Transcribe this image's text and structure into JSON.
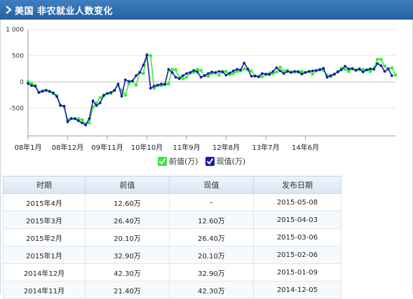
{
  "header": {
    "title": "美国 非农就业人数变化",
    "icon": "chevron-right-icon"
  },
  "legend": {
    "prev_label": "前值(万)",
    "curr_label": "现值(万)"
  },
  "table": {
    "headers": [
      "时期",
      "前值",
      "现值",
      "发布日期"
    ],
    "rows": [
      [
        "2015年4月",
        "12.60万",
        "–",
        "2015-05-08"
      ],
      [
        "2015年3月",
        "26.40万",
        "12.60万",
        "2015-04-03"
      ],
      [
        "2015年2月",
        "20.10万",
        "26.40万",
        "2015-03-06"
      ],
      [
        "2015年1月",
        "32.90万",
        "20.10万",
        "2015-02-06"
      ],
      [
        "2014年12月",
        "42.30万",
        "32.90万",
        "2015-01-09"
      ],
      [
        "2014年11月",
        "21.40万",
        "42.30万",
        "2014-12-05"
      ]
    ]
  },
  "chart_data": {
    "type": "line",
    "ylim": [
      -1000,
      1000
    ],
    "yticks": [
      1000,
      500,
      0,
      -500
    ],
    "ytick_labels": [
      "1 000",
      "500",
      "0",
      "-500"
    ],
    "xtick_labels": [
      "08年1月",
      "08年12月",
      "09年11月",
      "10年10月",
      "11年9月",
      "12年8月",
      "13年7月",
      "14年6月"
    ],
    "colors": {
      "prev": "#33ee33",
      "curr": "#1a1aaa",
      "axis": "#999999",
      "grid": "#e6e6e6"
    },
    "series": [
      {
        "name": "前值(万)",
        "values": [
          10,
          -30,
          -70,
          -200,
          -170,
          -160,
          -180,
          -220,
          -260,
          -440,
          -470,
          -720,
          -690,
          -700,
          -700,
          -720,
          -800,
          -780,
          -480,
          -400,
          -300,
          -250,
          -220,
          -220,
          -160,
          -60,
          -160,
          -250,
          -30,
          10,
          -60,
          180,
          160,
          520,
          500,
          -120,
          -70,
          -70,
          -40,
          -40,
          240,
          230,
          90,
          60,
          90,
          170,
          180,
          240,
          220,
          120,
          110,
          160,
          170,
          130,
          200,
          200,
          140,
          160,
          200,
          210,
          250,
          230,
          210,
          120,
          100,
          100,
          140,
          170,
          160,
          190,
          280,
          210,
          220,
          190,
          190,
          200,
          200,
          180,
          200,
          150,
          210,
          240,
          220,
          130,
          100,
          140,
          200,
          260,
          240,
          200,
          260,
          230,
          230,
          240,
          230,
          200,
          270,
          430,
          430,
          300,
          250,
          270,
          130
        ]
      },
      {
        "name": "现值(万)",
        "values": [
          -30,
          -70,
          -80,
          -200,
          -180,
          -160,
          -180,
          -210,
          -280,
          -450,
          -460,
          -760,
          -700,
          -700,
          -740,
          -780,
          -820,
          -700,
          -360,
          -450,
          -400,
          -260,
          -220,
          -200,
          -160,
          -40,
          -270,
          40,
          10,
          20,
          120,
          180,
          320,
          510,
          -120,
          -80,
          -60,
          -40,
          -50,
          240,
          180,
          90,
          60,
          120,
          160,
          180,
          220,
          190,
          90,
          120,
          160,
          190,
          180,
          200,
          190,
          130,
          170,
          210,
          240,
          230,
          360,
          250,
          110,
          110,
          100,
          160,
          150,
          140,
          200,
          270,
          210,
          160,
          200,
          180,
          200,
          190,
          150,
          180,
          200,
          210,
          220,
          230,
          260,
          90,
          120,
          150,
          190,
          230,
          300,
          250,
          250,
          220,
          250,
          190,
          230,
          250,
          240,
          350,
          310,
          200,
          250,
          120,
          null
        ]
      }
    ]
  }
}
